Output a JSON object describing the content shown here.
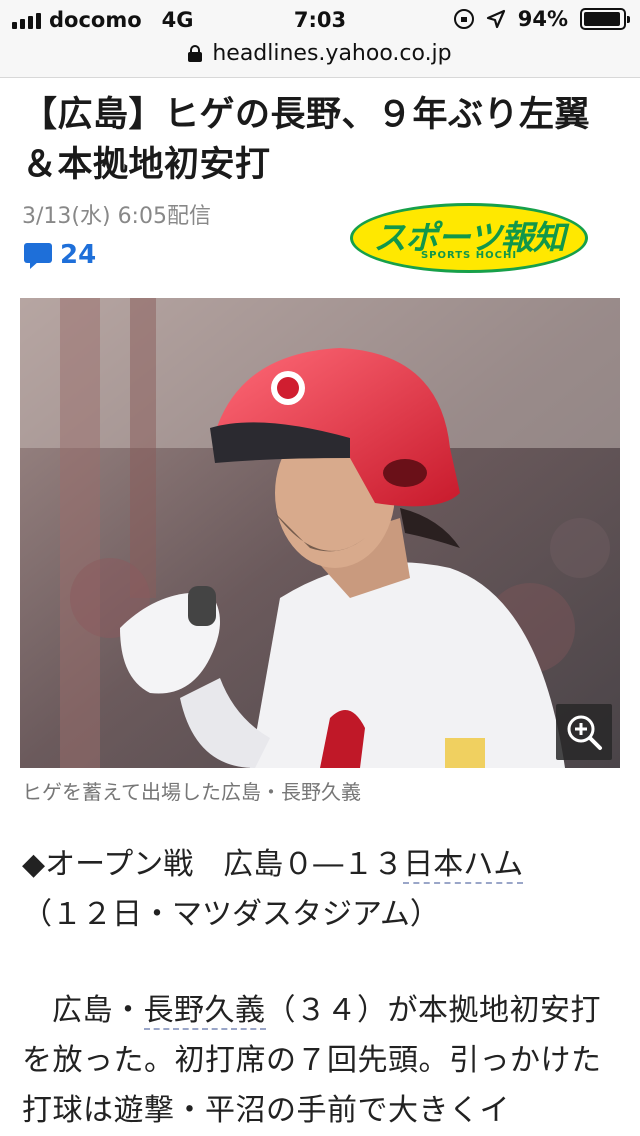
{
  "status_bar": {
    "carrier": "docomo",
    "network": "4G",
    "time": "7:03",
    "battery": "94%",
    "battery_level": 0.94
  },
  "url_bar": {
    "domain": "headlines.yahoo.co.jp"
  },
  "article": {
    "title": "【広島】ヒゲの長野、９年ぶり左翼＆本拠地初安打",
    "date": "3/13(水) 6:05配信",
    "comment_count": "24",
    "source_logo": {
      "name": "スポーツ報知",
      "sub": "SPORTS HOCHI",
      "fill_color": "#ffe800",
      "text_color": "#11974a"
    },
    "photo": {
      "caption": "ヒゲを蓄えて出場した広島・長野久義"
    },
    "para1": {
      "prefix": "◆オープン戦　広島０―１３",
      "team_link": "日本ハム",
      "suffix": "（１２日・マツダスタジアム）"
    },
    "para2": {
      "prefix": "広島・",
      "player_link": "長野久義",
      "text": "（３４）が本拠地初安打を放った。初打席の７回先頭。引っかけた打球は遊撃・平沼の手前で大きくイ"
    }
  },
  "icons": {
    "comment": "speech-bubble-icon",
    "zoom": "zoom-in-icon",
    "lock": "padlock-icon"
  }
}
